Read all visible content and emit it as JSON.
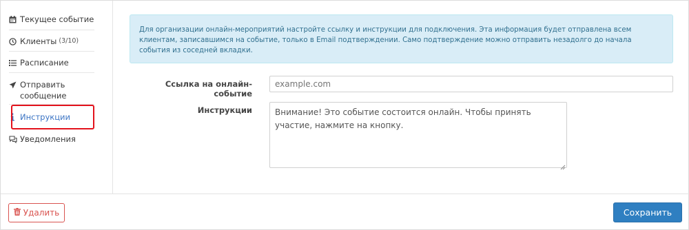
{
  "sidebar": {
    "items": [
      {
        "label": "Текущее событие",
        "icon": "calendar-icon"
      },
      {
        "label": "Клиенты",
        "count": "(3/10)",
        "icon": "clock-icon"
      },
      {
        "label": "Расписание",
        "icon": "list-icon"
      },
      {
        "label": "Отправить сообщение",
        "icon": "send-icon"
      },
      {
        "label": "Инструкции",
        "icon": "info-icon"
      },
      {
        "label": "Уведомления",
        "icon": "chat-icon"
      }
    ],
    "active_index": 4
  },
  "info_alert": {
    "text": "Для организации онлайн-мероприятий настройте ссылку и инструкции для подключения. Эта информация будет отправлена всем клиентам, записавшимся на событие, только в Email подтверждении. Само подтверждение можно отправить незадолго до начала события из соседней вкладки."
  },
  "form": {
    "link_label": "Ссылка на онлайн-событие",
    "link_placeholder": "example.com",
    "instructions_label": "Инструкции",
    "instructions_value": "Внимание! Это событие состоится онлайн. Чтобы принять участие, нажмите на кнопку."
  },
  "footer": {
    "delete_label": "Удалить",
    "save_label": "Сохранить"
  },
  "colors": {
    "accent": "#3b74c4",
    "danger": "#d9534f",
    "info_bg": "#d9edf7",
    "info_text": "#31708f",
    "primary_button": "#2f7fc1",
    "highlight": "#e3111b"
  }
}
